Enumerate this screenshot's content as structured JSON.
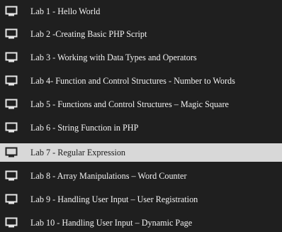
{
  "menu": {
    "active_index": 6,
    "icon": "monitor-icon",
    "colors": {
      "background": "#1f1f1f",
      "active_background": "#d8d8d8",
      "text": "#f2f2f2",
      "active_text": "#1a1a1a"
    },
    "items": [
      {
        "label": "Lab 1 - Hello World"
      },
      {
        "label": "Lab 2 -Creating Basic PHP Script"
      },
      {
        "label": "Lab 3 - Working with Data Types and Operators"
      },
      {
        "label": "Lab 4- Function and Control Structures - Number to Words"
      },
      {
        "label": "Lab 5 - Functions and Control Structures – Magic Square"
      },
      {
        "label": "Lab 6 - String Function in PHP"
      },
      {
        "label": "Lab 7 - Regular Expression"
      },
      {
        "label": "Lab 8 - Array Manipulations – Word Counter"
      },
      {
        "label": "Lab 9 - Handling User Input – User Registration"
      },
      {
        "label": "Lab 10 - Handling User Input – Dynamic Page"
      }
    ]
  }
}
